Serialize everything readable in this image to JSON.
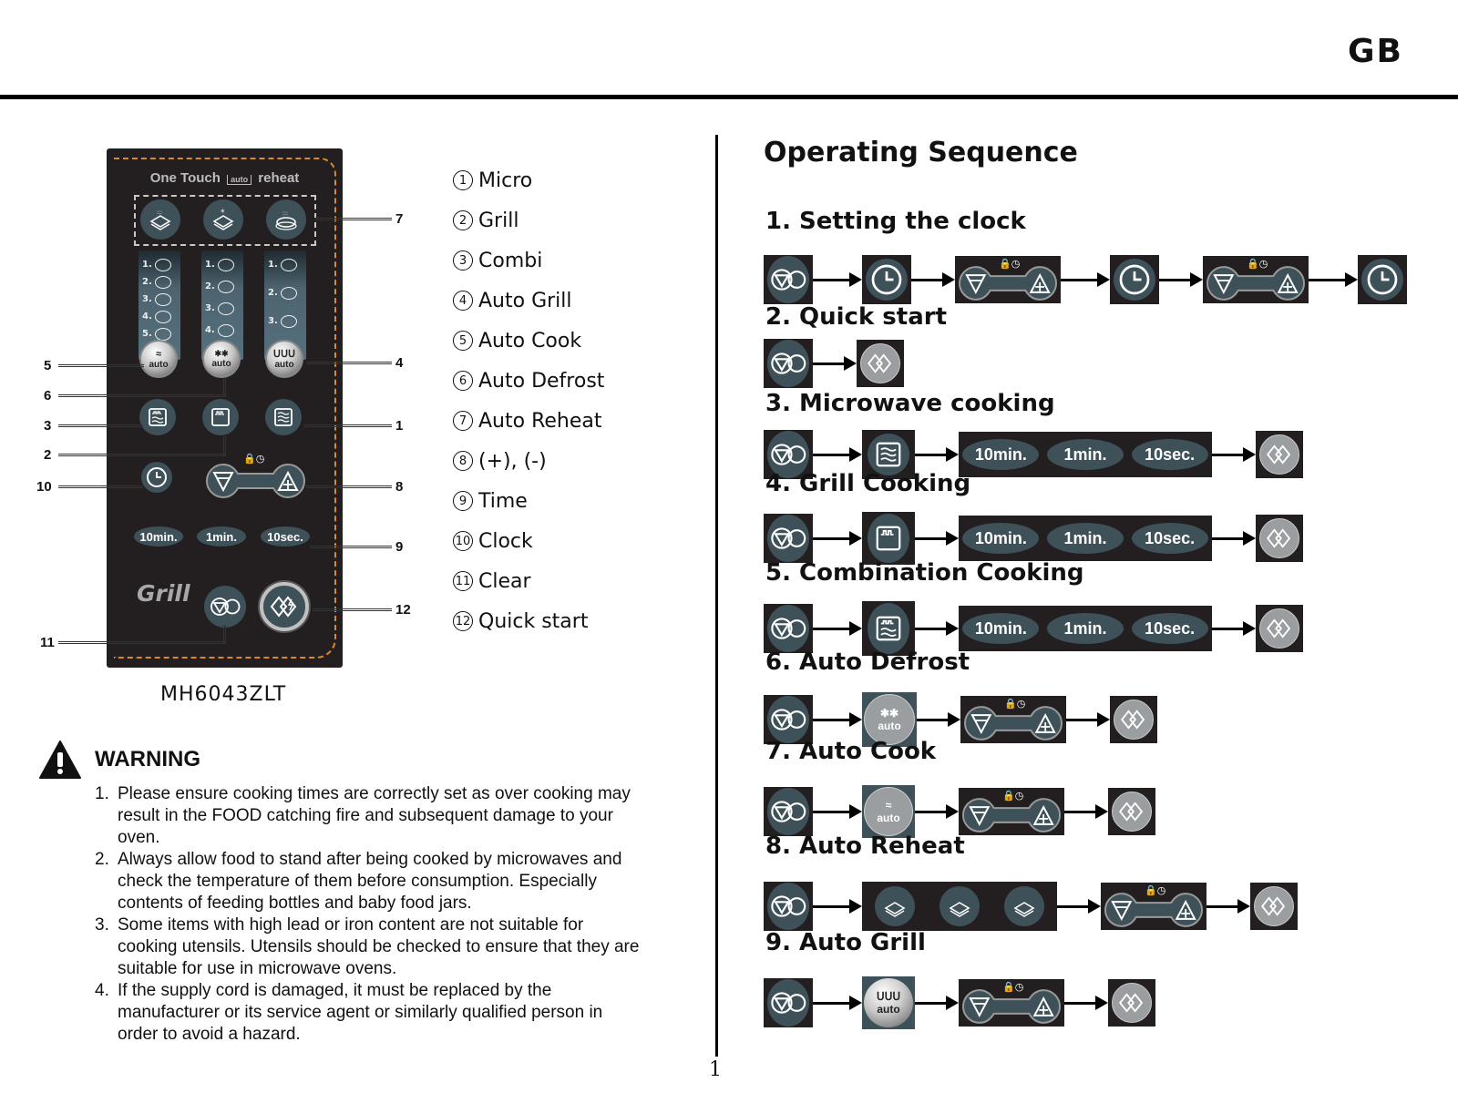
{
  "header": {
    "region_code": "GB"
  },
  "page_number": "1",
  "panel": {
    "title_left": "One Touch",
    "title_auto": "auto",
    "title_right": "reheat",
    "strips": [
      {
        "items": [
          "1.",
          "2.",
          "3.",
          "4.",
          "5."
        ]
      },
      {
        "items": [
          "1.",
          "2.",
          "3.",
          "4."
        ]
      },
      {
        "items": [
          "1.",
          "2.",
          "3."
        ]
      }
    ],
    "auto_labels": [
      "auto",
      "auto",
      "auto"
    ],
    "time_buttons": [
      "10min.",
      "1min.",
      "10sec."
    ],
    "grill_label": "Grill",
    "lock_clock_symbols": "🔒◷",
    "model": "MH6043ZLT"
  },
  "callouts": {
    "c1": "1",
    "c2": "2",
    "c3": "3",
    "c4": "4",
    "c5": "5",
    "c6": "6",
    "c7": "7",
    "c8": "8",
    "c9": "9",
    "c10": "10",
    "c11": "11",
    "c12": "12"
  },
  "legend": [
    {
      "num": "1",
      "label": "Micro"
    },
    {
      "num": "2",
      "label": "Grill"
    },
    {
      "num": "3",
      "label": "Combi"
    },
    {
      "num": "4",
      "label": "Auto Grill"
    },
    {
      "num": "5",
      "label": "Auto Cook"
    },
    {
      "num": "6",
      "label": "Auto Defrost"
    },
    {
      "num": "7",
      "label": "Auto Reheat"
    },
    {
      "num": "8",
      "label": "(+), (-)"
    },
    {
      "num": "9",
      "label": "Time"
    },
    {
      "num": "10",
      "label": "Clock"
    },
    {
      "num": "11",
      "label": "Clear"
    },
    {
      "num": "12",
      "label": "Quick start"
    }
  ],
  "warning": {
    "title": "WARNING",
    "items": [
      {
        "num": "1.",
        "text": "Please ensure cooking times are correctly set as over cooking may result in the FOOD catching fire and subsequent damage to your oven."
      },
      {
        "num": "2.",
        "text": "Always allow food to stand after being cooked by microwaves and check the temperature of them before consumption. Especially contents of feeding bottles and baby food jars."
      },
      {
        "num": "3.",
        "text": "Some items with high lead or iron content are not suitable for cooking utensils. Utensils should be checked to ensure that they are suitable for use in microwave ovens."
      },
      {
        "num": "4.",
        "text": "If the supply cord is damaged, it must be replaced by the manufacturer or its service agent or similarly qualified person in order to avoid a hazard."
      }
    ]
  },
  "operating": {
    "title": "Operating Sequence",
    "steps": [
      {
        "title": "1. Setting the clock",
        "sequence": [
          "clear",
          "clock",
          "plus-minus",
          "clock",
          "plus-minus",
          "clock"
        ]
      },
      {
        "title": "2. Quick start",
        "sequence": [
          "clear",
          "quick-start"
        ]
      },
      {
        "title": "3. Microwave cooking",
        "sequence": [
          "clear",
          "micro",
          "time",
          "quick-start"
        ]
      },
      {
        "title": "4. Grill Cooking",
        "sequence": [
          "clear",
          "grill",
          "time",
          "quick-start"
        ]
      },
      {
        "title": "5. Combination Cooking",
        "sequence": [
          "clear",
          "combi",
          "time",
          "quick-start"
        ]
      },
      {
        "title": "6. Auto Defrost",
        "sequence": [
          "clear",
          "auto-defrost",
          "plus-minus",
          "quick-start"
        ]
      },
      {
        "title": "7. Auto Cook",
        "sequence": [
          "clear",
          "auto-cook",
          "plus-minus",
          "quick-start"
        ]
      },
      {
        "title": "8. Auto Reheat",
        "sequence": [
          "clear",
          "auto-reheat",
          "plus-minus",
          "quick-start"
        ]
      },
      {
        "title": "9. Auto Grill",
        "sequence": [
          "clear",
          "auto-grill",
          "plus-minus",
          "quick-start"
        ]
      }
    ],
    "time_labels": [
      "10min.",
      "1min.",
      "10sec."
    ],
    "auto_label": "auto"
  }
}
